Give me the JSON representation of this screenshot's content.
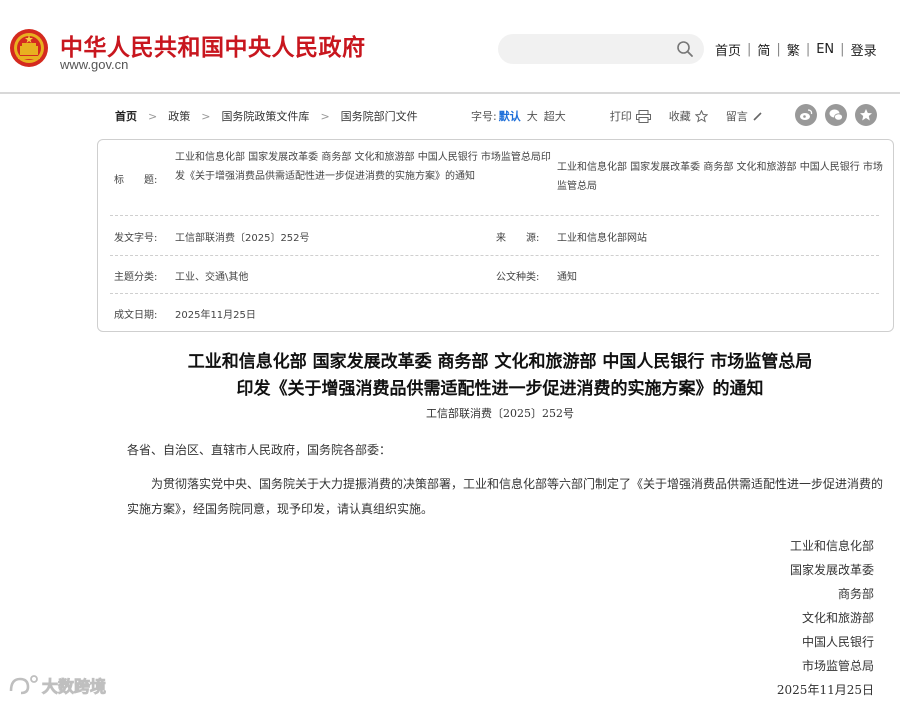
{
  "header": {
    "site_title": "中华人民共和国中央人民政府",
    "site_url": "www.gov.cn",
    "search_placeholder": "",
    "links": [
      "首页",
      "简",
      "繁",
      "EN",
      "登录"
    ],
    "brand_color": "#c8161e"
  },
  "breadcrumb": [
    "首页",
    "政策",
    "国务院政策文件库",
    "国务院部门文件"
  ],
  "toolbar": {
    "font_size_label": "字号:",
    "font_default": "默认",
    "font_large": "大",
    "font_xlarge": "超大",
    "print": "打印",
    "favorite": "收藏",
    "comment": "留言",
    "share_icons": [
      "weibo-icon",
      "wechat-icon",
      "star-icon"
    ]
  },
  "info": {
    "title_label": "标　　题:",
    "title_value": "工业和信息化部  国家发展改革委  商务部  文化和旅游部  中国人民银行  市场监管总局印发《关于增强消费品供需适配性进一步促进消费的实施方案》的通知",
    "issuer_value": "工业和信息化部  国家发展改革委  商务部  文化和旅游部  中国人民银行  市场监管总局",
    "doc_no_label": "发文字号:",
    "doc_no_value": "工信部联消费〔2025〕252号",
    "source_label": "来　　源:",
    "source_value": "工业和信息化部网站",
    "topic_label": "主题分类:",
    "topic_value": "工业、交通\\其他",
    "type_label": "公文种类:",
    "type_value": "通知",
    "date_label": "成文日期:",
    "date_value": "2025年11月25日"
  },
  "article": {
    "title_line1": "工业和信息化部  国家发展改革委  商务部  文化和旅游部  中国人民银行  市场监管总局",
    "title_line2": "印发《关于增强消费品供需适配性进一步促进消费的实施方案》的通知",
    "doc_no": "工信部联消费〔2025〕252号",
    "salutation": "各省、自治区、直辖市人民政府，国务院各部委：",
    "body": "为贯彻落实党中央、国务院关于大力提振消费的决策部署，工业和信息化部等六部门制定了《关于增强消费品供需适配性进一步促进消费的实施方案》，经国务院同意，现予印发，请认真组织实施。",
    "signatures": [
      "工业和信息化部",
      "国家发展改革委",
      "商务部",
      "文化和旅游部",
      "中国人民银行",
      "市场监管总局"
    ],
    "sign_date": "2025年11月25日"
  },
  "watermark": "大数跨境"
}
